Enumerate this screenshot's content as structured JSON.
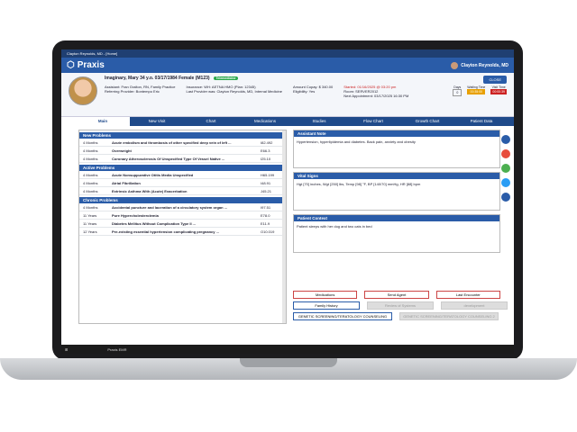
{
  "window_title": "Clayton Reynolds, MD - [Home]",
  "app_name": "Praxis",
  "user_name": "Clayton Reynolds, MD",
  "patient": {
    "name": "Imaginary, Mary 34 y.o. 03/17/1984 Female (M123)",
    "telemedicine": "Telemedicine",
    "assistant": "Assistant: Fran Gralton, RN, Family Practice",
    "referring": "Referring Provider: Bontempo Eric",
    "insurance": "Insurance: WH: AETNA HMO (Plan: 12345)",
    "last_provider": "Last Provider was: Clayton Reynolds, MD, Internal Medicine",
    "copay": "Amount Copay: $ 340.00",
    "eligibility": "Eligibility: Yes",
    "started": "Started: 01/16/2025 @ 03:20 pm",
    "room": "Room: SERVER2012",
    "next_appt": "Next Appointment: 03/17/2025 16:30 PM",
    "days_label": "Days",
    "waiting_label": "Waiting Time",
    "visit_label": "Visit Time",
    "days": "0",
    "waiting": "00:35:00",
    "visit": "00:00:39"
  },
  "close_label": "CLOSE",
  "tabs": [
    "Main",
    "New Visit",
    "Chart",
    "Medications",
    "Studies",
    "Flow Chart",
    "Growth Chart",
    "Patient Data"
  ],
  "new_problems": {
    "title": "New Problems",
    "rows": [
      [
        "4 Months",
        "Acute embolism and thrombosis of other specified deep vein of left ...",
        "I82.492"
      ],
      [
        "4 Months",
        "Overweight",
        "E66.3"
      ],
      [
        "4 Months",
        "Coronary Atherosclerosis Of Unspecified Type Of Vessel Native ...",
        "I25.10"
      ]
    ]
  },
  "active_problems": {
    "title": "Active Problems",
    "rows": [
      [
        "4 Months",
        "Acute Nonsuppurative Otitis Media Unspecified",
        "H65.199"
      ],
      [
        "4 Months",
        "Atrial Fibrillation",
        "I48.91"
      ],
      [
        "4 Months",
        "Extrinsic Asthma With (Acute) Exacerbation",
        "J45.21"
      ]
    ]
  },
  "chronic_problems": {
    "title": "Chronic Problems",
    "rows": [
      [
        "4 Months",
        "Accidental puncture and laceration of a circulatory system organ ...",
        "I97.51"
      ],
      [
        "11 Years",
        "Pure Hypercholesterolemia",
        "E78.0"
      ],
      [
        "11 Years",
        "Diabetes Mellitus Without Complication Type II ...",
        "E11.9"
      ],
      [
        "12 Years",
        "Pre-existing essential hypertension complicating pregnancy ...",
        "O10.019"
      ]
    ]
  },
  "assistant_note": {
    "title": "Assistant Note",
    "text": "Hypertension, hyperlipidemia and diabetes. Back pain, anxiety and obesity"
  },
  "vital_signs": {
    "title": "Vital Signs",
    "text": "Hgt [70] inches, Wgt [250] lbs, Temp [98] °F, BP [140/70] mmHg, HR [88] bpm"
  },
  "patient_context": {
    "title": "Patient Context",
    "text": "Patient sleeps with her dog and two cats in bed"
  },
  "buttons": {
    "medications": "Medications",
    "send_agent": "Send Agent",
    "last_encounter": "Last Encounter",
    "family_history": "Family History",
    "review_systems": "Review of Systems",
    "development": "development",
    "genetic1": "GENETIC SCREENING/TERATOLOGY COUNSELING",
    "genetic2": "GENETIC SCREENING/TERATOLOGY COUNSELING 2"
  },
  "taskbar_app": "Praxis EMR"
}
